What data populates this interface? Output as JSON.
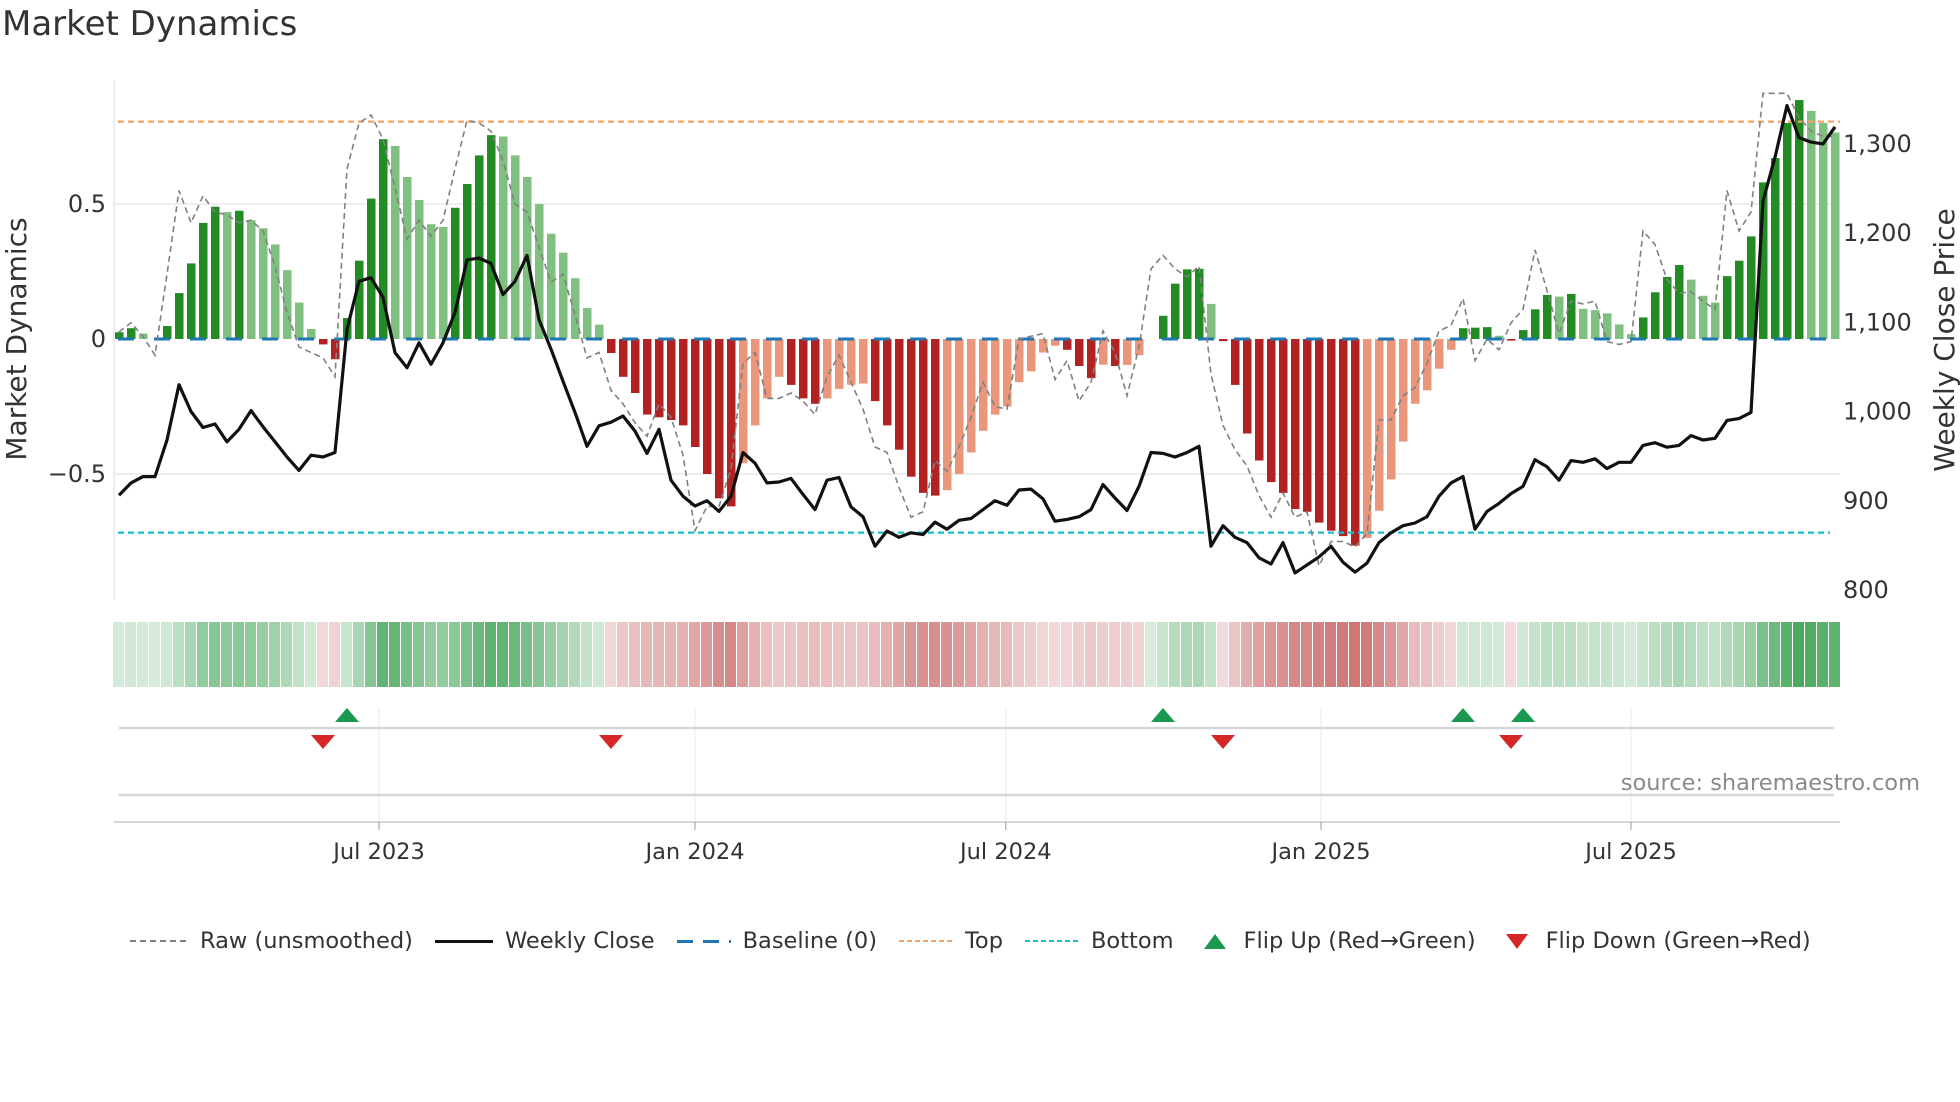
{
  "title": "Market Dynamics",
  "source": "source: sharemaestro.com",
  "colors": {
    "pos_rising": "#228b22",
    "pos_falling": "#7fbf7f",
    "neg_falling": "#b22222",
    "neg_rising": "#e9967a",
    "baseline": "#1f77b4",
    "top": "#f4a460",
    "bottom": "#17becf",
    "raw": "#808080",
    "close": "#111111",
    "flip_up": "#1a9850",
    "flip_down": "#d62728",
    "heat_pos": "#43a657",
    "heat_neg": "#c85f5f"
  },
  "legend": {
    "raw": "Raw (unsmoothed)",
    "close": "Weekly Close",
    "baseline": "Baseline (0)",
    "top": "Top",
    "bottom": "Bottom",
    "flip_up": "Flip Up (Red→Green)",
    "flip_down": "Flip Down (Green→Red)"
  },
  "chart_data": {
    "type": "bar",
    "title": "Market Dynamics",
    "ylabel": "Market Dynamics",
    "ylabel_right": "Weekly Close Price",
    "xlabel": "",
    "ylim": [
      -0.967,
      0.96
    ],
    "ylim_right": [
      788,
      1371
    ],
    "y_ticks": [
      {
        "value": 0.5,
        "label": "0.5"
      },
      {
        "value": 0,
        "label": "0"
      },
      {
        "value": -0.5,
        "label": "−0.5"
      }
    ],
    "y_ticks_right": [
      {
        "value": 1300,
        "label": "1,300"
      },
      {
        "value": 1200,
        "label": "1,200"
      },
      {
        "value": 1100,
        "label": "1,100"
      },
      {
        "value": 1000,
        "label": "1,000"
      },
      {
        "value": 900,
        "label": "900"
      },
      {
        "value": 800,
        "label": "800"
      }
    ],
    "x_ticks": [
      {
        "week": 21.67,
        "label": "Jul 2023"
      },
      {
        "week": 48,
        "label": "Jan 2024"
      },
      {
        "week": 73.9,
        "label": "Jul 2024"
      },
      {
        "week": 100.17,
        "label": "Jan 2025"
      },
      {
        "week": 126,
        "label": "Jul 2025"
      }
    ],
    "top_level": 0.805,
    "bottom_level": -0.717,
    "baseline": 0,
    "grid": true,
    "legend_position": "bottom",
    "series": [
      {
        "name": "Market Dynamics (smoothed)",
        "values": [
          0.025,
          0.04,
          0.02,
          0,
          0.048,
          0.17,
          0.28,
          0.43,
          0.49,
          0.47,
          0.475,
          0.44,
          0.41,
          0.35,
          0.255,
          0.135,
          0.037,
          -0.02,
          -0.075,
          0.078,
          0.29,
          0.52,
          0.74,
          0.715,
          0.6,
          0.515,
          0.425,
          0.415,
          0.486,
          0.574,
          0.68,
          0.755,
          0.75,
          0.68,
          0.6,
          0.5,
          0.39,
          0.32,
          0.225,
          0.115,
          0.053,
          -0.052,
          -0.14,
          -0.2,
          -0.28,
          -0.29,
          -0.3,
          -0.32,
          -0.4,
          -0.5,
          -0.59,
          -0.62,
          -0.46,
          -0.32,
          -0.22,
          -0.14,
          -0.17,
          -0.22,
          -0.24,
          -0.22,
          -0.185,
          -0.17,
          -0.165,
          -0.23,
          -0.32,
          -0.41,
          -0.51,
          -0.57,
          -0.58,
          -0.56,
          -0.5,
          -0.42,
          -0.34,
          -0.28,
          -0.25,
          -0.16,
          -0.12,
          -0.05,
          -0.025,
          -0.04,
          -0.1,
          -0.145,
          -0.095,
          -0.1,
          -0.096,
          -0.06,
          0,
          0.086,
          0.205,
          0.258,
          0.26,
          0.13,
          -0.008,
          -0.17,
          -0.35,
          -0.45,
          -0.53,
          -0.57,
          -0.63,
          -0.64,
          -0.68,
          -0.71,
          -0.73,
          -0.765,
          -0.737,
          -0.636,
          -0.52,
          -0.38,
          -0.24,
          -0.19,
          -0.11,
          -0.04,
          0.04,
          0.042,
          0.044,
          0.012,
          -0.006,
          0.033,
          0.11,
          0.163,
          0.157,
          0.167,
          0.112,
          0.107,
          0.095,
          0.054,
          0.018,
          0.08,
          0.173,
          0.23,
          0.274,
          0.22,
          0.16,
          0.135,
          0.233,
          0.29,
          0.38,
          0.58,
          0.67,
          0.8,
          0.885,
          0.845,
          0.8,
          0.765
        ]
      },
      {
        "name": "Raw (unsmoothed)",
        "values": [
          0.026,
          0.06,
          0.01,
          -0.06,
          0.24,
          0.55,
          0.43,
          0.53,
          0.47,
          0.46,
          0.43,
          0.44,
          0.4,
          0.27,
          0.1,
          -0.03,
          -0.05,
          -0.07,
          -0.14,
          0.63,
          0.8,
          0.83,
          0.74,
          0.56,
          0.37,
          0.44,
          0.38,
          0.44,
          0.63,
          0.81,
          0.8,
          0.77,
          0.66,
          0.5,
          0.47,
          0.34,
          0.21,
          0.24,
          0.09,
          -0.07,
          -0.05,
          -0.19,
          -0.24,
          -0.31,
          -0.36,
          -0.24,
          -0.29,
          -0.43,
          -0.71,
          -0.62,
          -0.62,
          -0.48,
          -0.09,
          -0.05,
          -0.22,
          -0.22,
          -0.2,
          -0.23,
          -0.28,
          -0.14,
          -0.06,
          -0.16,
          -0.26,
          -0.4,
          -0.42,
          -0.55,
          -0.66,
          -0.64,
          -0.45,
          -0.49,
          -0.4,
          -0.29,
          -0.16,
          -0.25,
          -0.26,
          0.0,
          0.01,
          0.02,
          -0.15,
          -0.08,
          -0.23,
          -0.16,
          0.03,
          -0.05,
          -0.21,
          -0.03,
          0.26,
          0.31,
          0.26,
          0.23,
          0.27,
          -0.13,
          -0.32,
          -0.41,
          -0.47,
          -0.58,
          -0.66,
          -0.57,
          -0.66,
          -0.64,
          -0.84,
          -0.75,
          -0.75,
          -0.77,
          -0.72,
          -0.3,
          -0.3,
          -0.21,
          -0.18,
          -0.09,
          0.03,
          0.05,
          0.15,
          -0.08,
          0.0,
          -0.04,
          0.06,
          0.11,
          0.33,
          0.18,
          0.02,
          0.14,
          0.13,
          0.14,
          -0.01,
          -0.02,
          -0.01,
          0.4,
          0.35,
          0.22,
          0.17,
          0.175,
          0.14,
          0.11,
          0.55,
          0.4,
          0.47,
          0.91,
          0.91,
          0.91,
          0.82,
          0.77,
          0.75,
          0.75
        ]
      },
      {
        "name": "Weekly Close",
        "axis": "right",
        "values": [
          905,
          919,
          926,
          926,
          967,
          1029,
          999,
          981,
          985,
          965,
          979,
          1000,
          982,
          965,
          948,
          933,
          950,
          948,
          953,
          1091,
          1145,
          1149,
          1127,
          1065,
          1048,
          1076,
          1052,
          1076,
          1110,
          1169,
          1171,
          1165,
          1130,
          1145,
          1174,
          1102,
          1069,
          1033,
          998,
          960,
          983,
          987,
          994,
          977,
          952,
          979,
          922,
          904,
          893,
          899,
          887,
          904,
          953,
          941,
          919,
          920,
          924,
          906,
          889,
          922,
          925,
          892,
          881,
          848,
          865,
          858,
          863,
          861,
          875,
          867,
          877,
          879,
          889,
          899,
          894,
          911,
          912,
          901,
          876,
          878,
          881,
          889,
          917,
          902,
          888,
          915,
          953,
          952,
          948,
          953,
          960,
          848,
          871,
          858,
          852,
          835,
          828,
          852,
          818,
          827,
          836,
          848,
          830,
          819,
          829,
          852,
          863,
          871,
          874,
          881,
          904,
          919,
          926,
          867,
          887,
          896,
          907,
          915,
          945,
          937,
          922,
          944,
          942,
          946,
          935,
          942,
          942,
          961,
          964,
          959,
          961,
          972,
          967,
          969,
          989,
          991,
          998,
          1235,
          1284,
          1342,
          1306,
          1301,
          1299,
          1318
        ]
      }
    ],
    "flips": [
      {
        "week": 17,
        "type": "down"
      },
      {
        "week": 19,
        "type": "up"
      },
      {
        "week": 41,
        "type": "down"
      },
      {
        "week": 87,
        "type": "up"
      },
      {
        "week": 92,
        "type": "down"
      },
      {
        "week": 112,
        "type": "up"
      },
      {
        "week": 116,
        "type": "down"
      },
      {
        "week": 117,
        "type": "up"
      }
    ]
  }
}
